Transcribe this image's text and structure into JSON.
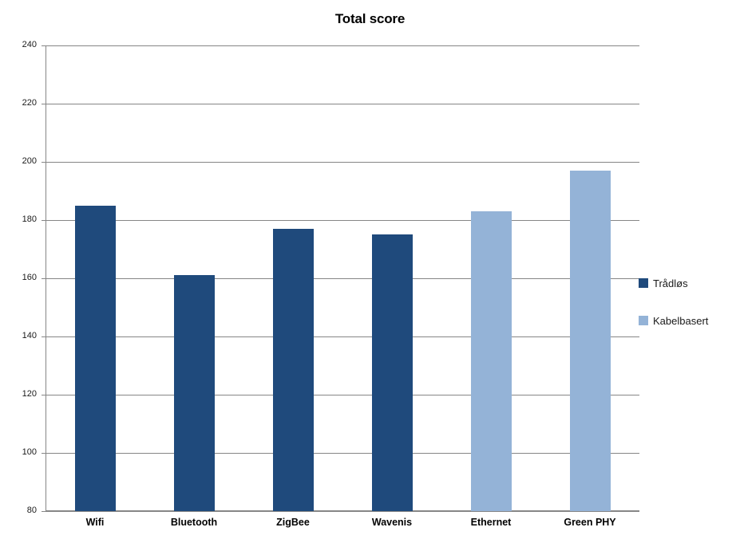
{
  "chart_data": {
    "type": "bar",
    "title": "Total score",
    "xlabel": "",
    "ylabel": "",
    "categories": [
      "Wifi",
      "Bluetooth",
      "ZigBee",
      "Wavenis",
      "Ethernet",
      "Green PHY"
    ],
    "values": [
      185,
      161,
      177,
      175,
      183,
      197
    ],
    "point_series": [
      "Trådløs",
      "Trådløs",
      "Trådløs",
      "Trådløs",
      "Kabelbasert",
      "Kabelbasert"
    ],
    "series": [
      {
        "name": "Trådløs",
        "color": "#1f4a7c",
        "categories": [
          "Wifi",
          "Bluetooth",
          "ZigBee",
          "Wavenis"
        ],
        "values": [
          185,
          161,
          177,
          175
        ]
      },
      {
        "name": "Kabelbasert",
        "color": "#94b3d7",
        "categories": [
          "Ethernet",
          "Green PHY"
        ],
        "values": [
          183,
          197
        ]
      }
    ],
    "ylim": [
      80,
      240
    ],
    "ytick_step": 20,
    "yticks": [
      240,
      220,
      200,
      180,
      160,
      140,
      120,
      100,
      80
    ],
    "ytick_labels": [
      "240",
      "220",
      "200",
      "180",
      "160",
      "140",
      "120",
      "100",
      "80"
    ],
    "grid": true,
    "grid_axis": "y",
    "legend_position": "right",
    "legend": [
      {
        "label": "Trådløs",
        "color": "#1f4a7c"
      },
      {
        "label": "Kabelbasert",
        "color": "#94b3d7"
      }
    ],
    "colors": {
      "wireless": "#1f4a7c",
      "wired": "#94b3d7",
      "axis": "#868686",
      "text": "#1a1a1a",
      "background": "#ffffff"
    }
  }
}
